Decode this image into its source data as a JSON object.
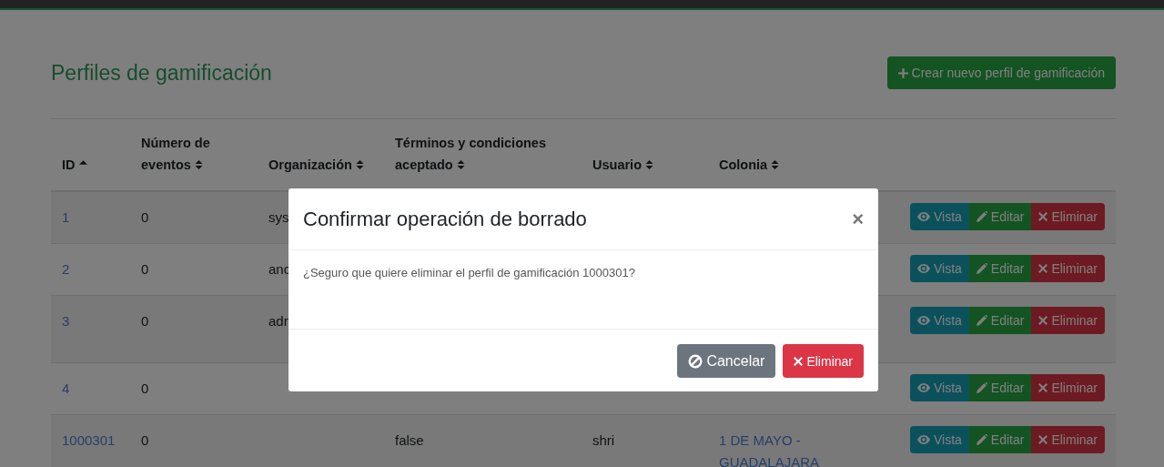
{
  "page": {
    "title": "Perfiles de gamificación",
    "create_button": "Crear nuevo perfil de gamificación"
  },
  "table": {
    "columns": [
      {
        "label": "ID",
        "sorted": true
      },
      {
        "label": "Número de eventos",
        "sorted": false
      },
      {
        "label": "Organización",
        "sorted": false
      },
      {
        "label": "Términos y condiciones aceptado",
        "sorted": false
      },
      {
        "label": "Usuario",
        "sorted": false
      },
      {
        "label": "Colonia",
        "sorted": false
      }
    ],
    "rows": [
      {
        "cells": [
          "1",
          "0",
          "sys",
          "",
          "",
          ""
        ],
        "actions": [
          "Vista",
          "Editar",
          "Eliminar"
        ]
      },
      {
        "cells": [
          "2",
          "0",
          "anc",
          "",
          "",
          ""
        ],
        "actions": [
          "Vista",
          "Editar",
          "Eliminar"
        ]
      },
      {
        "cells": [
          "3",
          "0",
          "adr",
          "",
          "",
          ""
        ],
        "actions": [
          "Vista",
          "Editar",
          "Eliminar"
        ]
      },
      {
        "cells": [
          "4",
          "0",
          "",
          "",
          "",
          ""
        ],
        "actions": [
          "Vista",
          "Editar",
          "Eliminar"
        ]
      },
      {
        "cells": [
          "1000301",
          "0",
          "",
          "false",
          "shri",
          "1 DE MAYO - GUADALAJARA"
        ],
        "actions": [
          "Vista",
          "Editar",
          "Eliminar"
        ]
      }
    ]
  },
  "modal": {
    "title": "Confirmar operación de borrado",
    "close": "×",
    "message": "¿Seguro que quiere eliminar el perfil de gamificación 1000301?",
    "buttons": [
      {
        "label": "Cancelar",
        "kind": "cancel"
      },
      {
        "label": "Eliminar",
        "kind": "delete"
      }
    ]
  }
}
